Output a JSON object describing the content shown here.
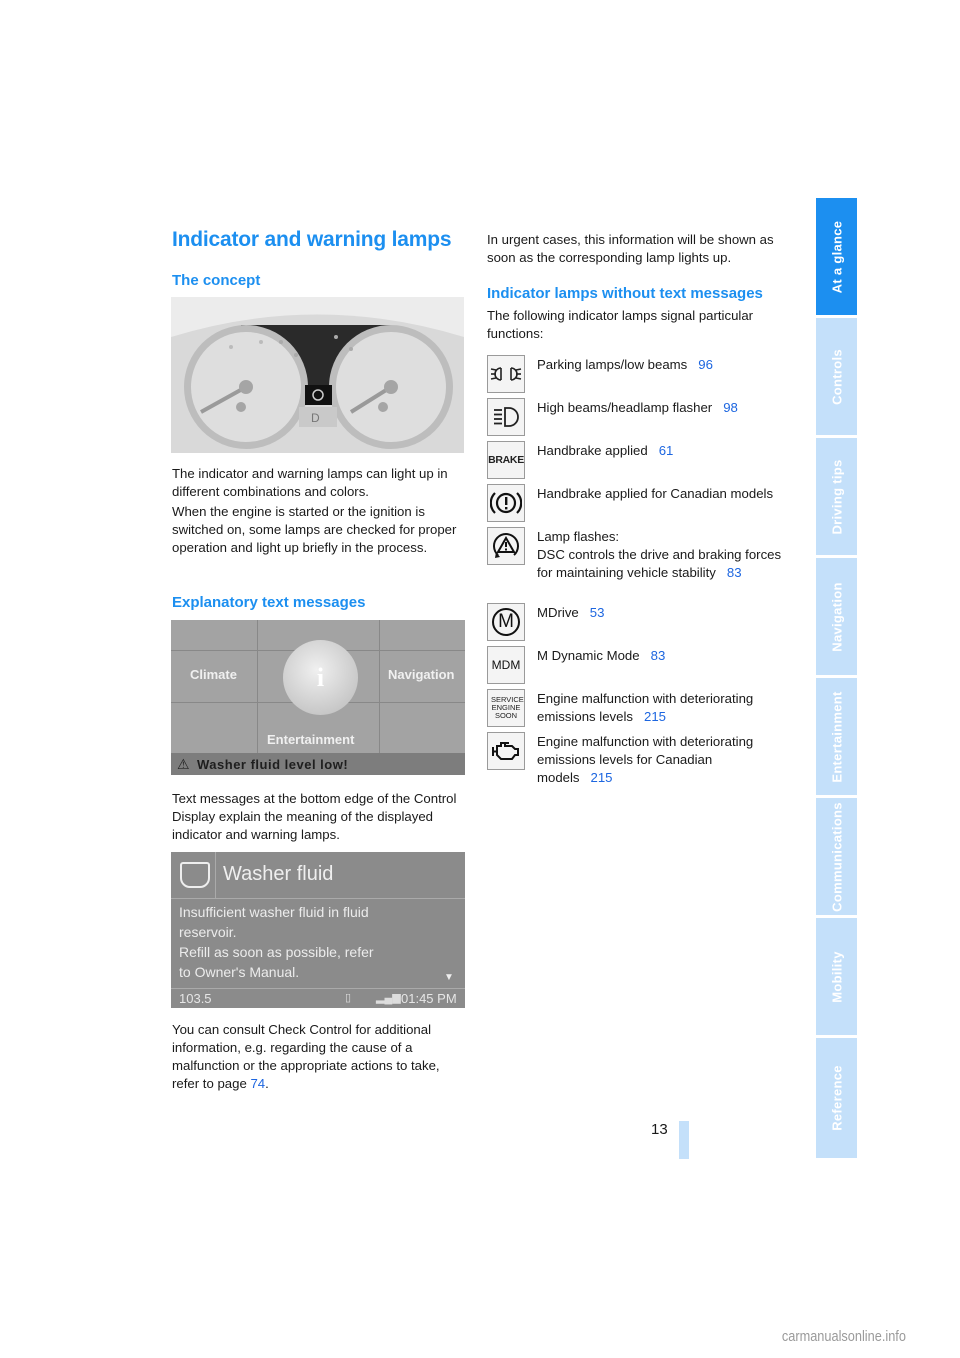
{
  "page": {
    "title": "Indicator and warning lamps",
    "page_number": "13",
    "watermark": "carmanualsonline.info"
  },
  "sidebar": {
    "tabs": [
      {
        "label": "At a glance",
        "active": true
      },
      {
        "label": "Controls",
        "active": false
      },
      {
        "label": "Driving tips",
        "active": false
      },
      {
        "label": "Navigation",
        "active": false
      },
      {
        "label": "Entertainment",
        "active": false
      },
      {
        "label": "Communications",
        "active": false
      },
      {
        "label": "Mobility",
        "active": false
      },
      {
        "label": "Reference",
        "active": false
      }
    ]
  },
  "left": {
    "concept_heading": "The concept",
    "concept_p1": "The indicator and warning lamps can light up in different combinations and colors.",
    "concept_p2": "When the engine is started or the ignition is switched on, some lamps are checked for proper operation and light up briefly in the process.",
    "explanatory_heading": "Explanatory text messages",
    "explanatory_p1": "Text messages at the bottom edge of the Control Display explain the meaning of the displayed indicator and warning lamps.",
    "check_control_p_before": "You can consult Check Control for additional information, e.g. regarding the cause of a malfunction or the appropriate actions to take, refer to page ",
    "check_control_link": "74",
    "check_control_p_after": "."
  },
  "figures": {
    "menu": {
      "climate": "Climate",
      "navigation": "Navigation",
      "entertainment": "Entertainment",
      "warning": "Washer fluid level low!"
    },
    "washer": {
      "title": "Washer fluid",
      "body_line1": "Insufficient washer fluid in fluid",
      "body_line2": "reservoir.",
      "body_line3": "Refill as soon as possible, refer",
      "body_line4": "to Owner's Manual.",
      "status_left": "103.5",
      "status_time": "01:45 PM"
    }
  },
  "right": {
    "urgent_p": "In urgent cases, this information will be shown as soon as the corresponding lamp lights up.",
    "without_heading": "Indicator lamps without text messages",
    "without_intro": "The following indicator lamps signal particular functions:",
    "lamps": [
      {
        "icon": "parking-lamps-icon",
        "text": "Parking lamps/low beams",
        "page": "96"
      },
      {
        "icon": "high-beam-icon",
        "text": "High beams/headlamp flasher",
        "page": "98"
      },
      {
        "icon": "brake-icon",
        "icon_text": "BRAKE",
        "text": "Handbrake applied",
        "page": "61"
      },
      {
        "icon": "handbrake-canada-icon",
        "text": "Handbrake applied for Canadian models",
        "page": ""
      },
      {
        "icon": "dsc-icon",
        "text_line1": "Lamp flashes:",
        "text": "DSC controls the drive and braking forces for maintaining vehicle stability",
        "page": "83"
      },
      {
        "icon": "mdrive-icon",
        "icon_text": "M",
        "text": "MDrive",
        "page": "53"
      },
      {
        "icon": "mdm-icon",
        "icon_text": "MDM",
        "text": "M Dynamic Mode",
        "page": "83"
      },
      {
        "icon": "service-engine-soon-icon",
        "icon_text": "SERVICE ENGINE SOON",
        "text": "Engine malfunction with deteriorating emissions levels",
        "page": "215"
      },
      {
        "icon": "check-engine-icon",
        "text": "Engine malfunction with deteriorating emissions levels for Canadian models",
        "page": "215"
      }
    ]
  }
}
